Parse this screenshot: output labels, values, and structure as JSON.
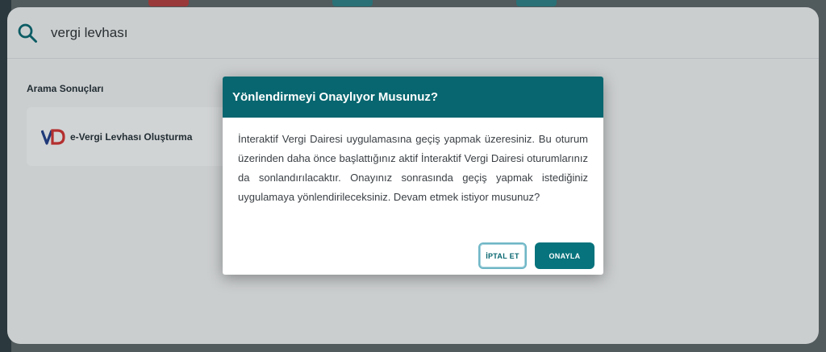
{
  "search": {
    "value": "vergi levhası"
  },
  "results": {
    "title": "Arama Sonuçları",
    "items": [
      {
        "label": "e-Vergi Levhası Oluşturma",
        "icon": "vd-logo-icon"
      }
    ]
  },
  "modal": {
    "title": "Yönlendirmeyi Onaylıyor Musunuz?",
    "body": "İnteraktif Vergi Dairesi uygulamasına geçiş yapmak üzeresiniz. Bu oturum üzerinden daha önce başlattığınız aktif İnteraktif Vergi Dairesi oturumlarınız da sonlandırılacaktır. Onayınız sonrasında geçiş yapmak istediğiniz uygulamaya yönlendirileceksiniz. Devam etmek istiyor musunuz?",
    "cancel_label": "İPTAL ET",
    "confirm_label": "ONAYLA"
  },
  "colors": {
    "primary": "#07666f",
    "confirm": "#07737c",
    "logo_red": "#d32f2f",
    "logo_blue": "#1f3c88"
  }
}
